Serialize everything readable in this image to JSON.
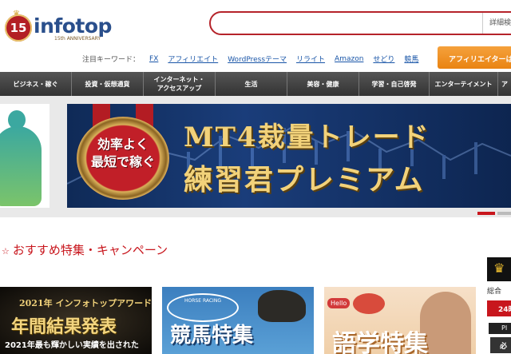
{
  "header": {
    "logo_number": "15",
    "logo_word": "infotop",
    "logo_sub": "15th ANNIVERSARY",
    "search_placeholder": "",
    "advanced_search_label": "詳細検",
    "affiliate_button_label": "アフィリエイターは",
    "keywords_label": "注目キーワード：",
    "keywords": [
      "FX",
      "アフィリエイト",
      "WordPressテーマ",
      "リライト",
      "Amazon",
      "せどり",
      "競馬"
    ]
  },
  "nav": {
    "items": [
      "ビジネス・稼ぐ",
      "投資・仮想通貨",
      "インターネット・\nアクセスアップ",
      "生活",
      "美容・健康",
      "学習・自己啓発",
      "エンターテイメント",
      "ア"
    ]
  },
  "banner": {
    "medal_text_line1": "効率よく",
    "medal_text_line2": "最短で稼ぐ",
    "title_line1": "MT4裁量トレード",
    "title_line2": "練習君プレミアム"
  },
  "section": {
    "title": "おすすめ特集・キャンペーン"
  },
  "cards": [
    {
      "line1": "2021年 インフォトップアワード",
      "line2": "年間結果発表",
      "line3": "2021年最も輝かしい実績を出された"
    },
    {
      "badge": "HORSE RACING",
      "title": "競馬特集"
    },
    {
      "hello": "Hello",
      "title": "語学特集"
    }
  ],
  "ranking": {
    "label": "総合",
    "button": "24時",
    "tab": "PI",
    "img_text": "必"
  }
}
